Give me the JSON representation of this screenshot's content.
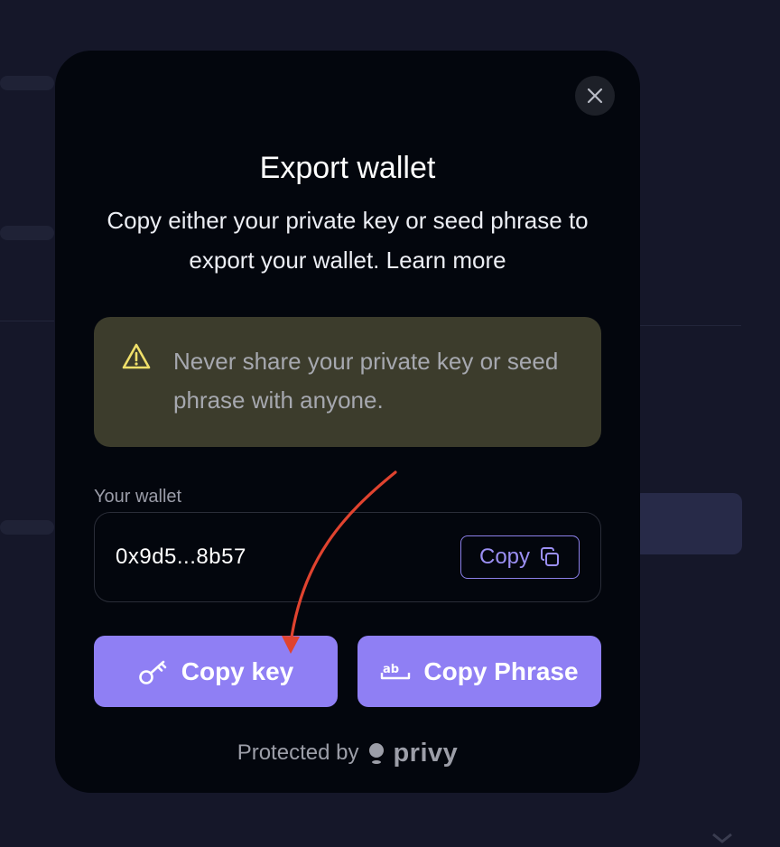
{
  "modal": {
    "title": "Export wallet",
    "subtitle_text": "Copy either your private key or seed phrase to export your wallet.",
    "learn_more": "Learn more",
    "close_icon": "close-icon"
  },
  "warning": {
    "icon": "warning-triangle-icon",
    "text": "Never share your private key or seed phrase with anyone."
  },
  "wallet": {
    "label": "Your wallet",
    "address": "0x9d5...8b57",
    "copy_label": "Copy",
    "copy_icon": "copy-icon"
  },
  "actions": {
    "copy_key_label": "Copy key",
    "copy_key_icon": "key-icon",
    "copy_phrase_label": "Copy Phrase",
    "copy_phrase_icon": "text-ab-icon"
  },
  "footer": {
    "protected_by": "Protected by",
    "brand": "privy"
  },
  "colors": {
    "accent": "#8f7ff4",
    "modal_bg": "#03060d",
    "warning_bg": "#3c3c2c",
    "warning_icon": "#f0e06a",
    "annotation_arrow": "#e0432f"
  }
}
